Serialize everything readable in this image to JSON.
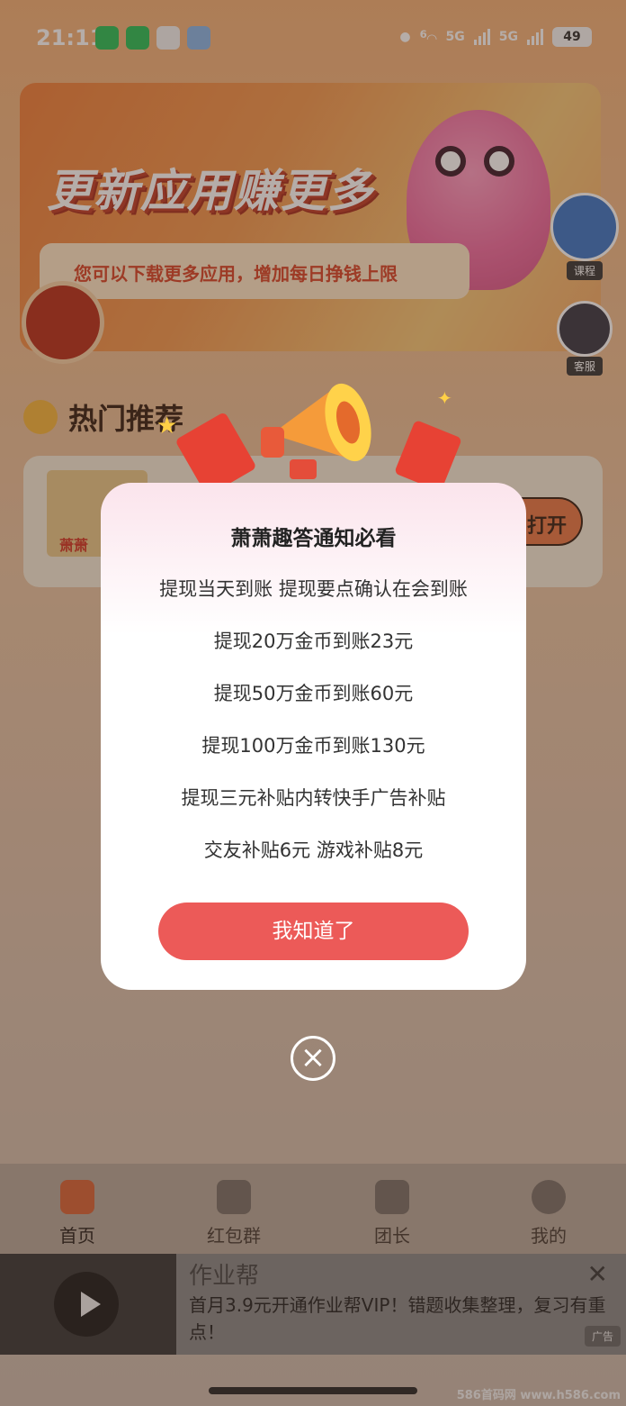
{
  "status_bar": {
    "time": "21:11",
    "network_1": "5G",
    "network_2": "5G",
    "wifi_badge": "6",
    "battery": "49"
  },
  "banner": {
    "title": "更新应用赚更多",
    "subtitle": "您可以下载更多应用，增加每日挣钱上限",
    "course_label": "课程",
    "service_label": "客服"
  },
  "recommend": {
    "title": "热门推荐",
    "app_thumb_text": "萧萧",
    "open_label": "打开"
  },
  "dialog": {
    "title": "萧萧趣答通知必看",
    "lines": [
      "提现当天到账 提现要点确认在会到账",
      "提现20万金币到账23元",
      "提现50万金币到账60元",
      "提现100万金币到账130元",
      "提现三元补贴内转快手广告补贴",
      "交友补贴6元 游戏补贴8元"
    ],
    "confirm_label": "我知道了",
    "close_icon": "circle-x-icon"
  },
  "nav": {
    "items": [
      {
        "label": "首页",
        "icon": "home-icon"
      },
      {
        "label": "红包群",
        "icon": "red-packet-group-icon"
      },
      {
        "label": "团长",
        "icon": "leader-icon"
      },
      {
        "label": "我的",
        "icon": "profile-icon"
      }
    ]
  },
  "ad": {
    "app_name": "作业帮",
    "description": "首月3.9元开通作业帮VIP！错题收集整理，复习有重点！",
    "badge": "广告",
    "close": "✕"
  },
  "watermark": "586首码网 www.h586.com",
  "colors": {
    "accent": "#ec5a58",
    "banner_orange": "#f0823e",
    "nav_active": "#d9663a"
  }
}
